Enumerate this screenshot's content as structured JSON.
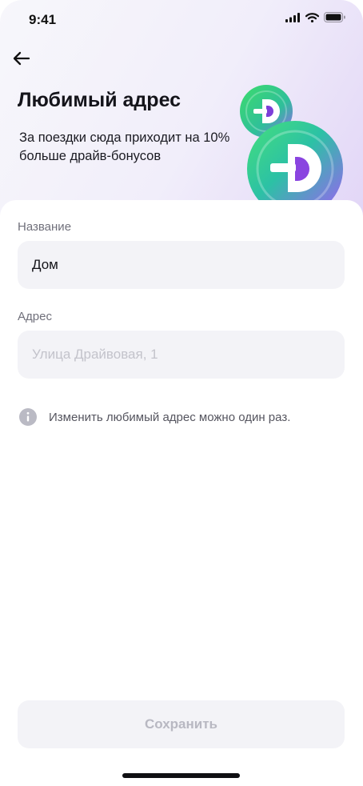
{
  "status_bar": {
    "time": "9:41"
  },
  "header": {
    "title": "Любимый адрес",
    "subtitle": "За поездки сюда приходит на 10% больше драйв-бонусов"
  },
  "form": {
    "name_label": "Название",
    "name_value": "Дом",
    "address_label": "Адрес",
    "address_placeholder": "Улица Драйвовая, 1"
  },
  "info": {
    "text": "Изменить любимый адрес можно один раз."
  },
  "actions": {
    "save_label": "Сохранить"
  },
  "icons": {
    "back": "arrow-left-icon",
    "signal": "cellular-signal-icon",
    "wifi": "wifi-icon",
    "battery": "battery-icon",
    "info": "info-icon",
    "coin": "drive-bonus-coin-icon"
  },
  "colors": {
    "accent_green": "#3ddc6c",
    "accent_purple": "#9b5cf6",
    "field_bg": "#f3f3f7",
    "disabled_text": "#b8b8c2"
  }
}
